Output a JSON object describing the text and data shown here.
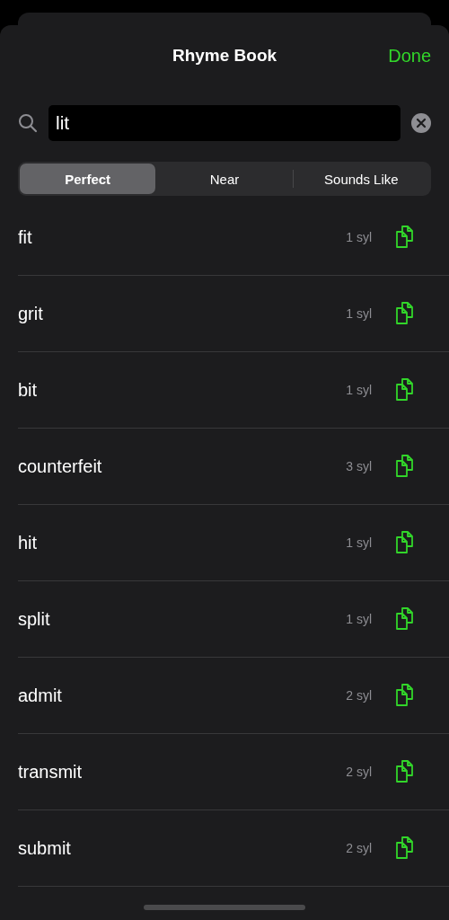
{
  "header": {
    "title": "Rhyme Book",
    "done": "Done"
  },
  "search": {
    "value": "lit"
  },
  "segments": [
    {
      "label": "Perfect",
      "selected": true
    },
    {
      "label": "Near",
      "selected": false
    },
    {
      "label": "Sounds Like",
      "selected": false
    }
  ],
  "rhymes": [
    {
      "word": "fit",
      "syllables": "1 syl"
    },
    {
      "word": "grit",
      "syllables": "1 syl"
    },
    {
      "word": "bit",
      "syllables": "1 syl"
    },
    {
      "word": "counterfeit",
      "syllables": "3 syl"
    },
    {
      "word": "hit",
      "syllables": "1 syl"
    },
    {
      "word": "split",
      "syllables": "1 syl"
    },
    {
      "word": "admit",
      "syllables": "2 syl"
    },
    {
      "word": "transmit",
      "syllables": "2 syl"
    },
    {
      "word": "submit",
      "syllables": "2 syl"
    }
  ]
}
